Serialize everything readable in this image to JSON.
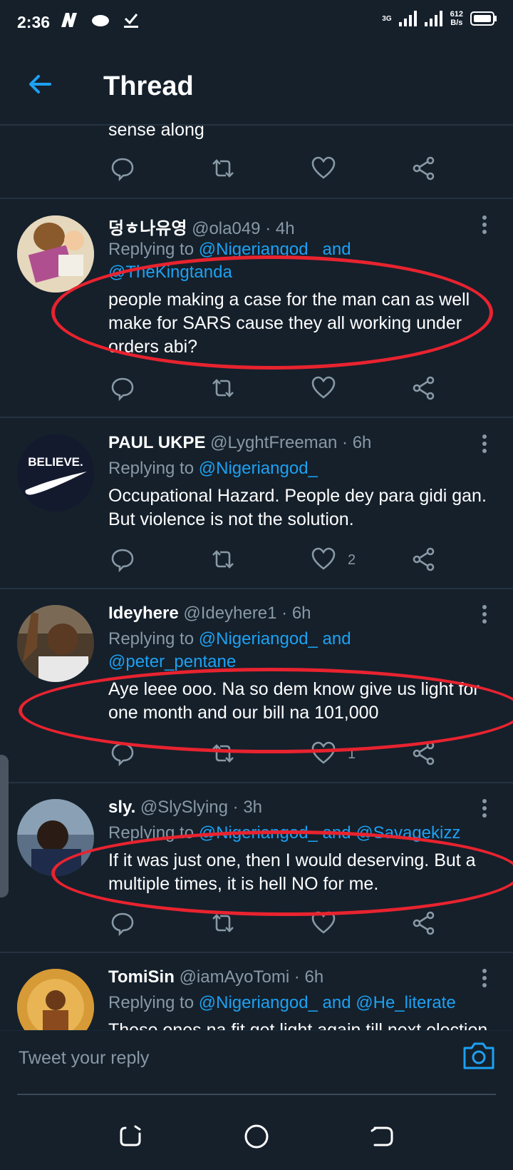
{
  "status_bar": {
    "time": "2:36",
    "network_type": "3G",
    "speed_value": "612",
    "speed_unit": "B/s"
  },
  "app_bar": {
    "title": "Thread"
  },
  "previous_fragment": {
    "text": "sense along"
  },
  "tweets": [
    {
      "name": "덩ㅎ나유영",
      "handle": "@ola049",
      "time": "· 4h",
      "replying_prefix": "Replying to ",
      "mentions_line1": "@Nigeriangod_ and",
      "mentions_line2": "@TheKingtanda",
      "text": "people making a case for the man can as well make for SARS cause they all working under orders abi?",
      "like_count": ""
    },
    {
      "name": "PAUL UKPE",
      "handle": "@LyghtFreeman",
      "time": "· 6h",
      "replying_prefix": "Replying to ",
      "mentions_line1": "@Nigeriangod_",
      "text": "Occupational Hazard. People dey para gidi gan. But violence is not the solution.",
      "like_count": "2"
    },
    {
      "name": "Ideyhere",
      "handle": "@Ideyhere1",
      "time": "· 6h",
      "replying_prefix": "Replying to ",
      "mentions_line1": "@Nigeriangod_ and",
      "mentions_line2": "@peter_pentane",
      "text": "Aye leee ooo. Na so dem know give us light for one month and our bill na 101,000",
      "like_count": "1"
    },
    {
      "name": "sly.",
      "handle": "@SlySlying",
      "time": "· 3h",
      "replying_prefix": "Replying to ",
      "mentions_line1": "@Nigeriangod_ and @Savagekizz",
      "text": "If it was just one, then I would deserving. But a multiple times, it is hell NO for me.",
      "like_count": ""
    },
    {
      "name": "TomiSin",
      "handle": "@iamAyoTomi",
      "time": "· 6h",
      "replying_prefix": "Replying to ",
      "mentions_line1": "@Nigeriangod_ and @He_literate",
      "text": "These ones na fit get light again till next election",
      "like_count": ""
    }
  ],
  "avatar_texts": {
    "paul": "BELIEVE."
  },
  "compose": {
    "placeholder": "Tweet your reply"
  },
  "colors": {
    "background": "#15202b",
    "accent": "#1da1f2",
    "secondary_text": "#8899a6",
    "annotation": "#e8232f"
  },
  "icons": [
    "back-arrow-icon",
    "reply-icon",
    "retweet-icon",
    "like-icon",
    "share-icon",
    "more-icon",
    "camera-icon",
    "recents-icon",
    "home-icon",
    "back-nav-icon"
  ]
}
